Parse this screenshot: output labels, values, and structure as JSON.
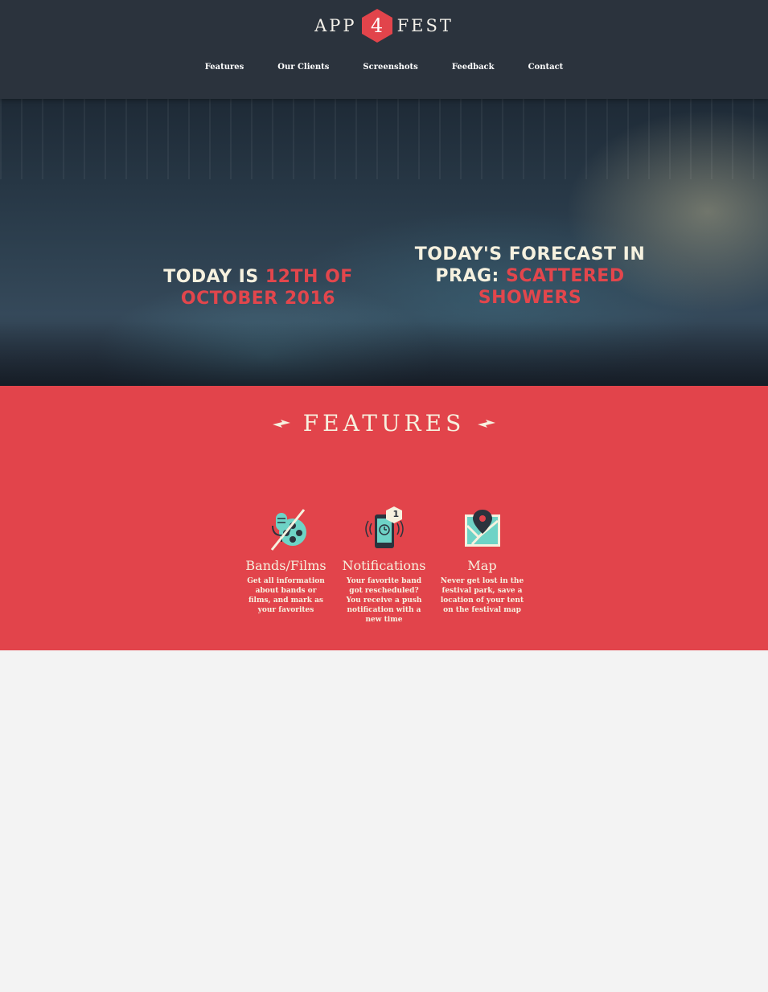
{
  "brand": {
    "left": "APP",
    "number": "4",
    "right": "FEST",
    "accent_color": "#e2444b",
    "header_color": "#2b333d"
  },
  "nav": {
    "items": [
      {
        "label": "Features"
      },
      {
        "label": "Our Clients"
      },
      {
        "label": "Screenshots"
      },
      {
        "label": "Feedback"
      },
      {
        "label": "Contact"
      }
    ]
  },
  "hero": {
    "date_prefix": "Today is",
    "date_value": "12th of October 2016",
    "forecast_prefix": "Today's forecast in Prag:",
    "forecast_value": "Scattered Showers"
  },
  "features": {
    "title": "FEATURES",
    "background": "#e2444b",
    "items": [
      {
        "icon": "microphone-film-reel-icon",
        "title": "Bands/Films",
        "text": "Get all information about bands or films, and mark as your favorites"
      },
      {
        "icon": "phone-notification-icon",
        "badge": "1",
        "title": "Notifications",
        "text": "Your favorite band got rescheduled? You receive a push notification with a new time"
      },
      {
        "icon": "map-pin-icon",
        "title": "Map",
        "text": "Never get lost in the festival park, save a location of your tent on the festival map"
      }
    ]
  }
}
